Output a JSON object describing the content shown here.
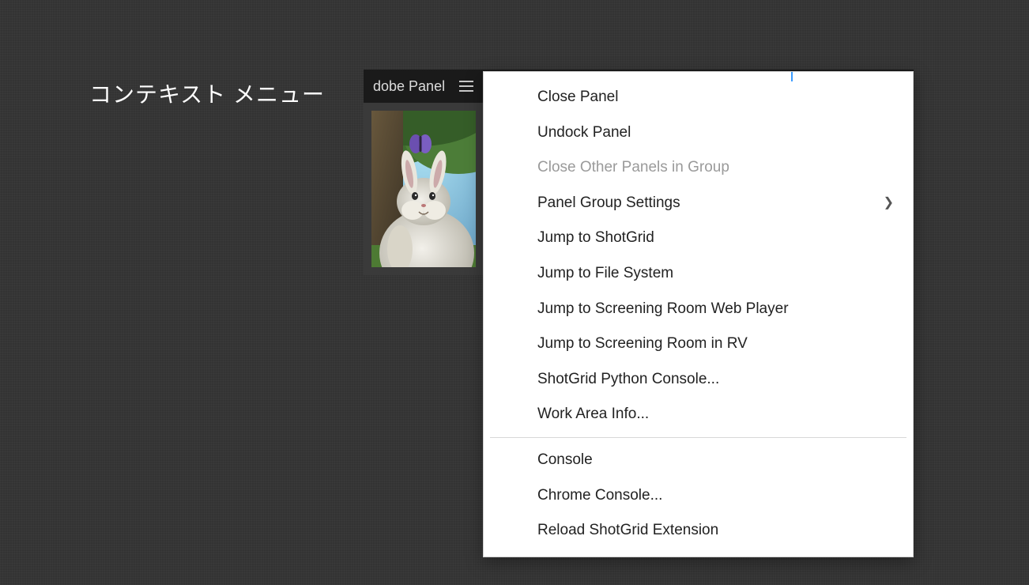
{
  "title": "コンテキスト メニュー",
  "panel": {
    "tab_label": "dobe Panel"
  },
  "menu": {
    "items": [
      {
        "label": "Close Panel",
        "disabled": false,
        "submenu": false
      },
      {
        "label": "Undock Panel",
        "disabled": false,
        "submenu": false
      },
      {
        "label": "Close Other Panels in Group",
        "disabled": true,
        "submenu": false
      },
      {
        "label": "Panel Group Settings",
        "disabled": false,
        "submenu": true
      },
      {
        "label": "Jump to ShotGrid",
        "disabled": false,
        "submenu": false
      },
      {
        "label": "Jump to File System",
        "disabled": false,
        "submenu": false
      },
      {
        "label": "Jump to Screening Room Web Player",
        "disabled": false,
        "submenu": false
      },
      {
        "label": "Jump to Screening Room in RV",
        "disabled": false,
        "submenu": false
      },
      {
        "label": "ShotGrid Python Console...",
        "disabled": false,
        "submenu": false
      },
      {
        "label": "Work Area Info...",
        "disabled": false,
        "submenu": false
      }
    ],
    "items2": [
      {
        "label": "Console",
        "disabled": false,
        "submenu": false
      },
      {
        "label": "Chrome Console...",
        "disabled": false,
        "submenu": false
      },
      {
        "label": "Reload ShotGrid Extension",
        "disabled": false,
        "submenu": false
      }
    ]
  }
}
